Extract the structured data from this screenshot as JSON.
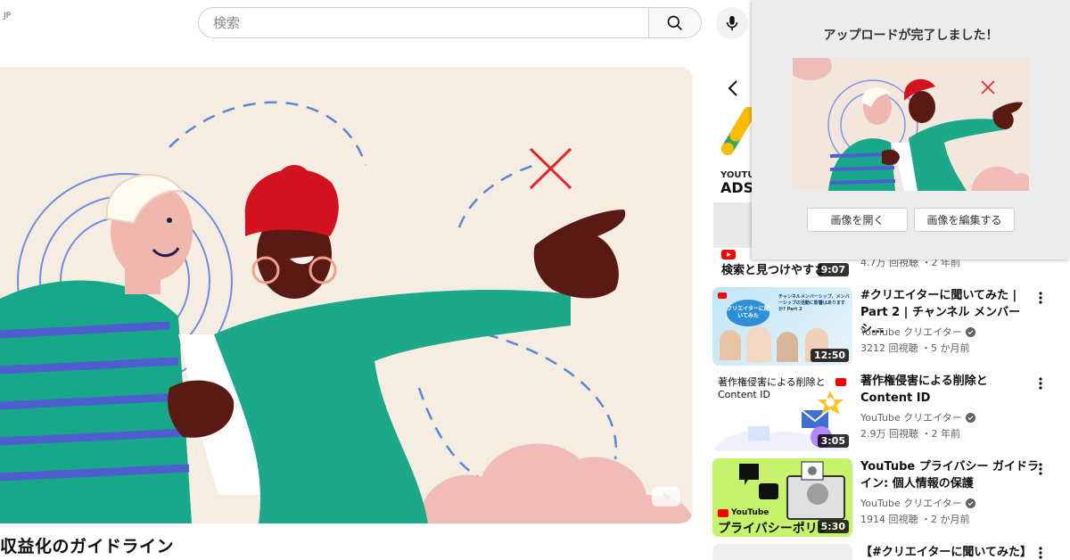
{
  "header": {
    "region": "JP",
    "search_placeholder": "検索"
  },
  "player": {
    "video_title": "収益化のガイドライン"
  },
  "promo": {
    "label_small": "YOUTUBE",
    "label_big": "ADSE"
  },
  "partial_row": {
    "thumb_text": "検索と見つけやすさ",
    "duration": "9:07",
    "meta": "4.7万 回視聴 ・2 年前"
  },
  "videos": [
    {
      "title_line1": "#クリエイターに聞いてみた |",
      "title_line2": "Part 2 | チャンネル メンバーシ…",
      "channel": "YouTube クリエイター",
      "meta": "3212 回視聴 ・5 か月前",
      "duration": "12:50",
      "thumb_badge": "クリエイターに聞いてみた",
      "thumb_caption": "チャンネルメンバーシップ、メンバーシップの活動に影響はありますか? Part 2"
    },
    {
      "title_line1": "著作権侵害による削除と",
      "title_line2": "Content ID",
      "channel": "YouTube クリエイター",
      "meta": "2.9万 回視聴 ・2 年前",
      "duration": "3:05",
      "thumb_line1": "著作権侵害による削除と",
      "thumb_line2": "Content ID"
    },
    {
      "title_line1": "YouTube プライバシー ガイドラ",
      "title_line2": "イン: 個人情報の保護",
      "channel": "YouTube クリエイター",
      "meta": "1914 回視聴 ・2 か月前",
      "duration": "5:30",
      "thumb_logo": "YouTube",
      "thumb_text": "プライバシーポリシ"
    },
    {
      "title_line1": "【#クリエイターに聞いてみた】"
    }
  ],
  "popup": {
    "title": "アップロードが完了しました！",
    "open_label": "画像を開く",
    "edit_label": "画像を編集する"
  },
  "colors": {
    "accent_red": "#ff0000",
    "teal": "#1fa88a",
    "beige": "#f5ece2",
    "pink": "#f1bcb7"
  }
}
